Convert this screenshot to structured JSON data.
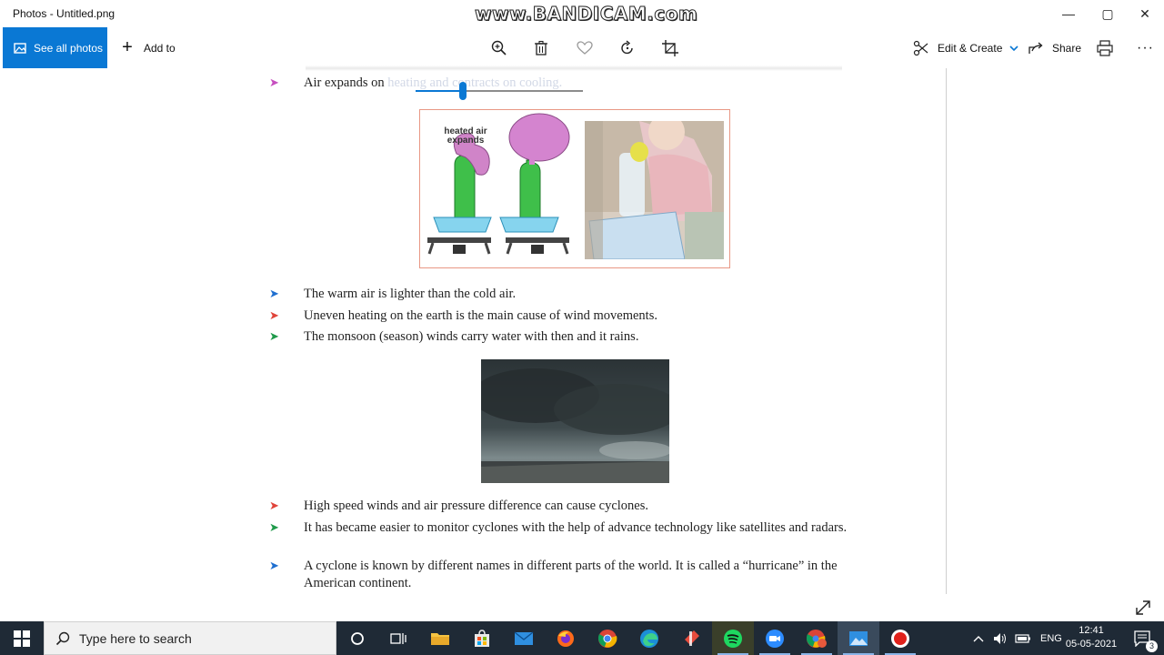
{
  "window": {
    "title": "Photos - Untitled.png",
    "watermark": "www.BANDICAM.com",
    "controls": {
      "minimize": "—",
      "maximize": "▢",
      "close": "✕"
    }
  },
  "toolbar": {
    "see_all_label": "See all photos",
    "add_to_label": "Add to",
    "edit_create_label": "Edit & Create",
    "share_label": "Share",
    "more_label": "···",
    "accent": "#0a78d4"
  },
  "document": {
    "line1_visible": "Air expands on ",
    "line1_faded": "heating and contracts on cooling.",
    "figure_caption": "heated air expands",
    "bullets_a": [
      {
        "text": "The warm air is lighter than the cold air.",
        "color": "#1f6fd0"
      },
      {
        "text": "Uneven heating on the earth is the main cause of wind movements.",
        "color": "#e0443a"
      },
      {
        "text": "The monsoon (season) winds carry water with then and it rains.",
        "color": "#1f9a4a"
      }
    ],
    "bullets_b": [
      {
        "text": "High speed winds and air pressure difference can cause cyclones.",
        "color": "#e0443a"
      },
      {
        "text": "It has became easier to monitor cyclones with the help of advance technology like satellites and radars.",
        "color": "#1f9a4a"
      },
      {
        "text": "A cyclone is known by different names in different parts of the world. It is called a “hurricane” in the American continent.",
        "color": "#1f6fd0"
      }
    ],
    "first_line_color": "#c64fbf"
  },
  "zoom_slider": {
    "value": 0.28
  },
  "taskbar": {
    "search_placeholder": "Type here to search",
    "language": "ENG",
    "time": "12:41",
    "date": "05-05-2021",
    "notification_count": "3",
    "apps": [
      "task-view",
      "file-explorer",
      "store",
      "mail",
      "firefox",
      "chrome",
      "edge",
      "paint",
      "spotify",
      "zoom",
      "chrome-profile",
      "photos",
      "bandicam-record"
    ]
  }
}
